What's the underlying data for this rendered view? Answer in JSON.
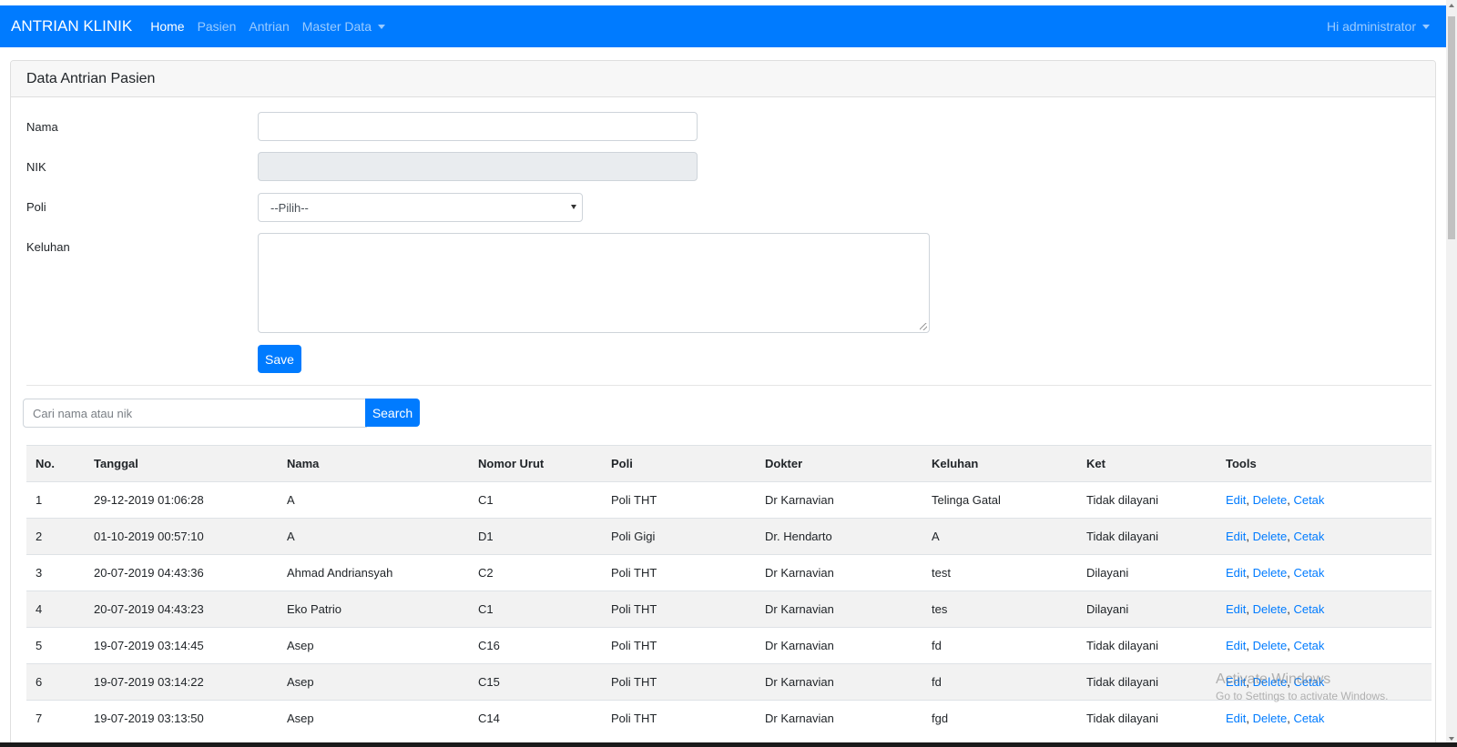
{
  "navbar": {
    "brand": "ANTRIAN KLINIK",
    "links": [
      {
        "label": "Home"
      },
      {
        "label": "Pasien"
      },
      {
        "label": "Antrian"
      },
      {
        "label": "Master Data"
      }
    ],
    "user_label": "Hi administrator"
  },
  "card": {
    "title": "Data Antrian Pasien"
  },
  "form": {
    "nama_label": "Nama",
    "nama_value": "",
    "nik_label": "NIK",
    "nik_value": "",
    "poli_label": "Poli",
    "poli_selected": "--Pilih--",
    "keluhan_label": "Keluhan",
    "keluhan_value": "",
    "save_label": "Save"
  },
  "search": {
    "placeholder": "Cari nama atau nik",
    "button_label": "Search"
  },
  "table": {
    "headers": [
      "No.",
      "Tanggal",
      "Nama",
      "Nomor Urut",
      "Poli",
      "Dokter",
      "Keluhan",
      "Ket",
      "Tools"
    ],
    "rows": [
      {
        "no": "1",
        "tanggal": "29-12-2019 01:06:28",
        "nama": "A",
        "nomor_urut": "C1",
        "poli": "Poli THT",
        "dokter": "Dr Karnavian",
        "keluhan": "Telinga Gatal",
        "ket": "Tidak dilayani"
      },
      {
        "no": "2",
        "tanggal": "01-10-2019 00:57:10",
        "nama": "A",
        "nomor_urut": "D1",
        "poli": "Poli Gigi",
        "dokter": "Dr. Hendarto",
        "keluhan": "A",
        "ket": "Tidak dilayani"
      },
      {
        "no": "3",
        "tanggal": "20-07-2019 04:43:36",
        "nama": "Ahmad Andriansyah",
        "nomor_urut": "C2",
        "poli": "Poli THT",
        "dokter": "Dr Karnavian",
        "keluhan": "test",
        "ket": "Dilayani"
      },
      {
        "no": "4",
        "tanggal": "20-07-2019 04:43:23",
        "nama": "Eko Patrio",
        "nomor_urut": "C1",
        "poli": "Poli THT",
        "dokter": "Dr Karnavian",
        "keluhan": "tes",
        "ket": "Dilayani"
      },
      {
        "no": "5",
        "tanggal": "19-07-2019 03:14:45",
        "nama": "Asep",
        "nomor_urut": "C16",
        "poli": "Poli THT",
        "dokter": "Dr Karnavian",
        "keluhan": "fd",
        "ket": "Tidak dilayani"
      },
      {
        "no": "6",
        "tanggal": "19-07-2019 03:14:22",
        "nama": "Asep",
        "nomor_urut": "C15",
        "poli": "Poli THT",
        "dokter": "Dr Karnavian",
        "keluhan": "fd",
        "ket": "Tidak dilayani"
      },
      {
        "no": "7",
        "tanggal": "19-07-2019 03:13:50",
        "nama": "Asep",
        "nomor_urut": "C14",
        "poli": "Poli THT",
        "dokter": "Dr Karnavian",
        "keluhan": "fgd",
        "ket": "Tidak dilayani"
      }
    ],
    "tools": {
      "edit": "Edit",
      "delete": "Delete",
      "cetak": "Cetak",
      "separator": ", "
    }
  },
  "watermark": {
    "title": "Activate Windows",
    "subtitle": "Go to Settings to activate Windows."
  },
  "colors": {
    "primary": "#007bff",
    "card_header_bg": "#f7f7f7",
    "stripe_bg": "#f2f2f2"
  }
}
